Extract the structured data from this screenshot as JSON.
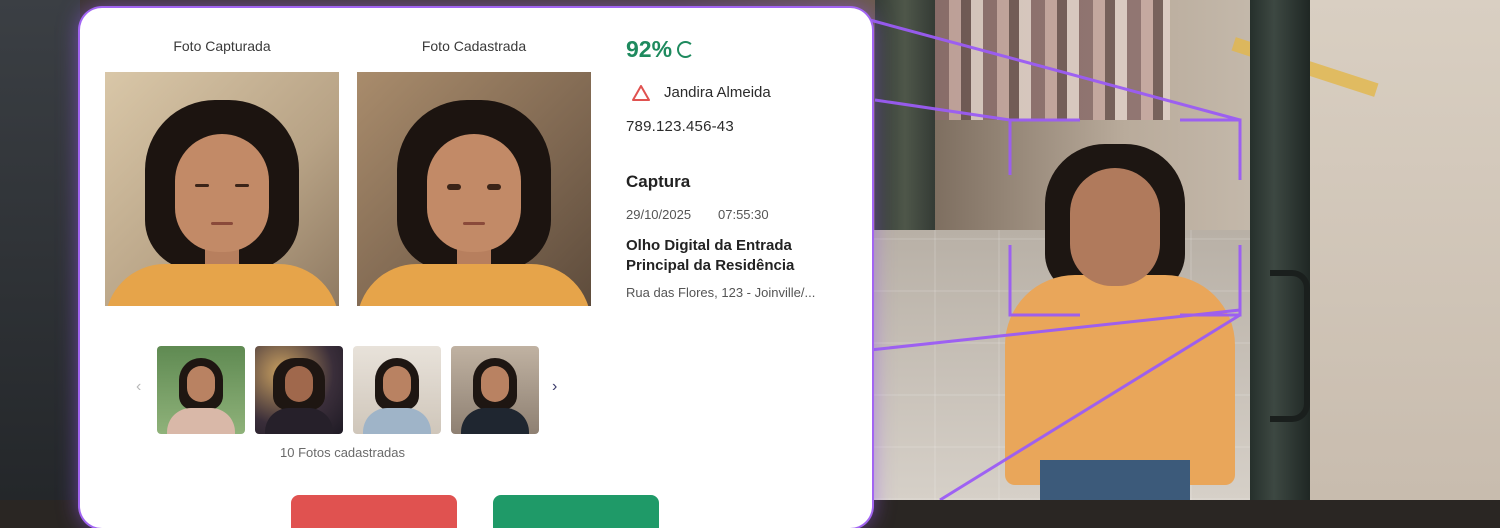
{
  "card": {
    "captured_title": "Foto Capturada",
    "registered_title": "Foto Cadastrada",
    "match_score": "92%",
    "person_name": "Jandira Almeida",
    "document_id": "789.123.456-43",
    "capture": {
      "title": "Captura",
      "date": "29/10/2025",
      "time": "07:55:30",
      "location": "Olho Digital da Entrada Principal da Residência",
      "address": "Rua das Flores, 123 - Joinville/..."
    },
    "gallery": {
      "count_label": "10 Fotos cadastradas",
      "prev_label": "‹",
      "next_label": "›"
    }
  },
  "colors": {
    "accent_green": "#1e8a5e",
    "warning_red": "#e05250",
    "highlight_purple": "#a265f2"
  },
  "icons": {
    "warning": "warning-triangle-icon",
    "loading": "loading-spinner-icon"
  }
}
